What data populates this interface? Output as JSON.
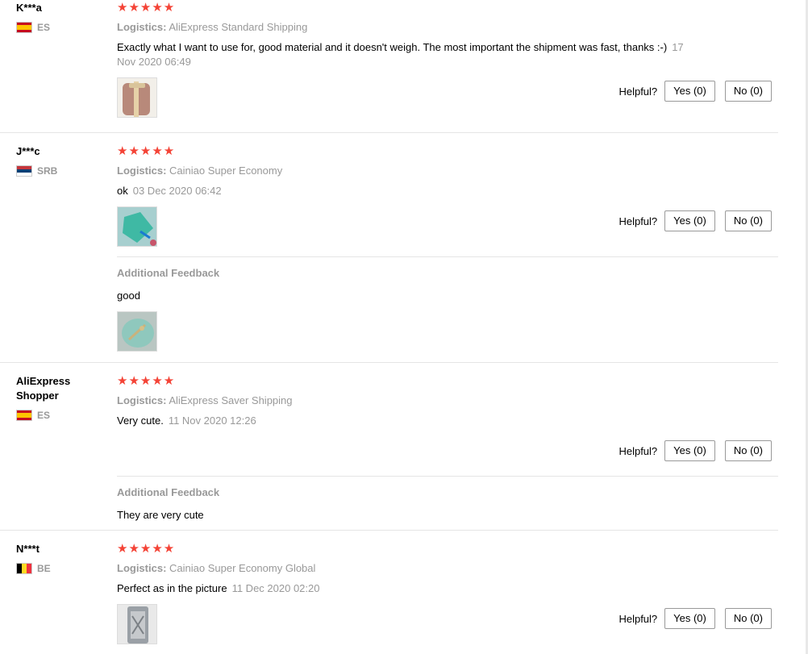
{
  "reviews": [
    {
      "user": "K***a",
      "country": "ES",
      "stars": "★★★★★",
      "logistics_label": "Logistics:",
      "logistics": "AliExpress Standard Shipping",
      "text": "Exactly what I want to use for, good material and it doesn't weigh. The most important the shipment was fast, thanks :-)",
      "date": "17 Nov 2020 06:49",
      "helpful_label": "Helpful?",
      "yes_label": "Yes (0)",
      "no_label": "No (0)"
    },
    {
      "user": "J***c",
      "country": "SRB",
      "stars": "★★★★★",
      "logistics_label": "Logistics:",
      "logistics": "Cainiao Super Economy",
      "text": "ok",
      "date": "03 Dec 2020 06:42",
      "helpful_label": "Helpful?",
      "yes_label": "Yes (0)",
      "no_label": "No (0)",
      "additional_title": "Additional Feedback",
      "additional_text": "good"
    },
    {
      "user": "AliExpress Shopper",
      "country": "ES",
      "stars": "★★★★★",
      "logistics_label": "Logistics:",
      "logistics": "AliExpress Saver Shipping",
      "text": "Very cute.",
      "date": "11 Nov 2020 12:26",
      "helpful_label": "Helpful?",
      "yes_label": "Yes (0)",
      "no_label": "No (0)",
      "additional_title": "Additional Feedback",
      "additional_text": "They are very cute"
    },
    {
      "user": "N***t",
      "country": "BE",
      "stars": "★★★★★",
      "logistics_label": "Logistics:",
      "logistics": "Cainiao Super Economy Global",
      "text": "Perfect as in the picture",
      "date": "11 Dec 2020 02:20",
      "helpful_label": "Helpful?",
      "yes_label": "Yes (0)",
      "no_label": "No (0)"
    }
  ]
}
